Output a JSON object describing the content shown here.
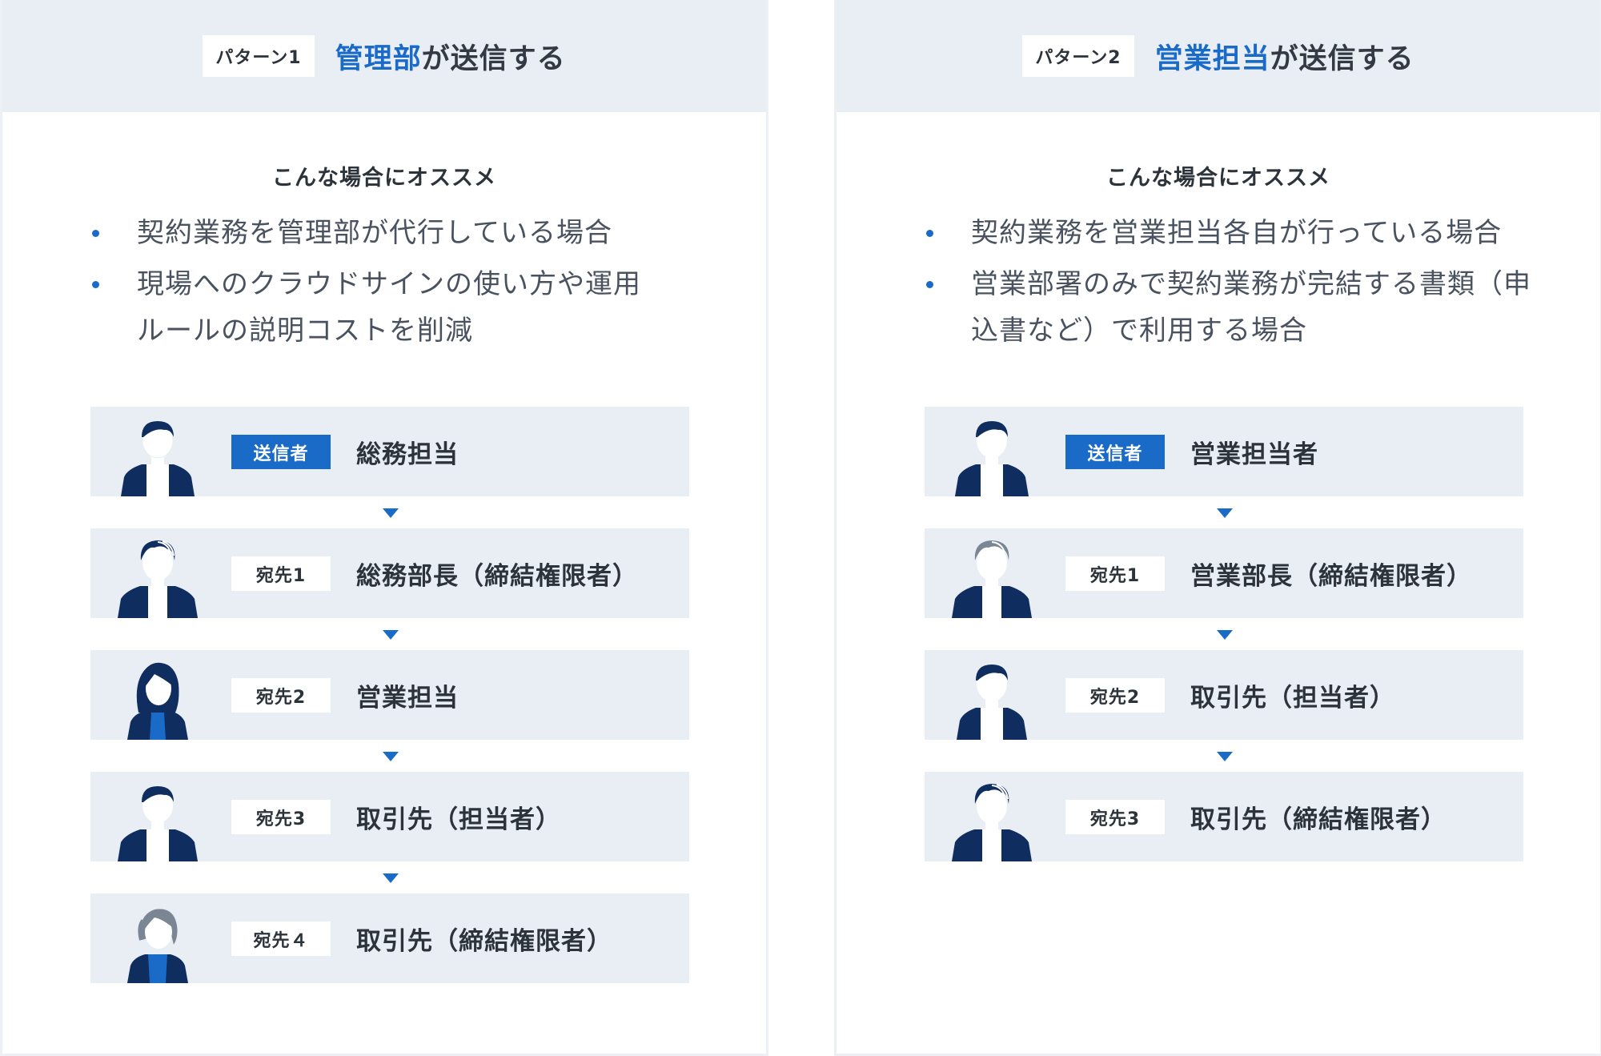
{
  "panels": [
    {
      "tag": "パターン1",
      "title_accent": "管理部",
      "title_rest": "が送信する",
      "rec_title": "こんな場合にオススメ",
      "bullets": [
        "契約業務を管理部が代行している場合",
        "現場へのクラウドサインの使い方や運用ルールの説明コストを削減"
      ],
      "steps": [
        {
          "tag": "送信者",
          "label": "総務担当",
          "avatar": "man-short-hair-icon"
        },
        {
          "tag": "宛先1",
          "label": "総務部長（締結権限者）",
          "avatar": "man-wavy-hair-icon"
        },
        {
          "tag": "宛先2",
          "label": "営業担当",
          "avatar": "woman-long-hair-icon"
        },
        {
          "tag": "宛先3",
          "label": "取引先（担当者）",
          "avatar": "man-short-hair-icon"
        },
        {
          "tag": "宛先４",
          "label": "取引先（締結権限者）",
          "avatar": "woman-gray-hair-icon"
        }
      ]
    },
    {
      "tag": "パターン2",
      "title_accent": "営業担当",
      "title_rest": "が送信する",
      "rec_title": "こんな場合にオススメ",
      "bullets": [
        "契約業務を営業担当各自が行っている場合",
        "営業部署のみで契約業務が完結する書類（申込書など）で利用する場合"
      ],
      "steps": [
        {
          "tag": "送信者",
          "label": "営業担当者",
          "avatar": "man-short-hair-icon"
        },
        {
          "tag": "宛先1",
          "label": "営業部長（締結権限者）",
          "avatar": "man-gray-hair-icon"
        },
        {
          "tag": "宛先2",
          "label": "取引先（担当者）",
          "avatar": "man-short-hair-icon"
        },
        {
          "tag": "宛先3",
          "label": "取引先（締結権限者）",
          "avatar": "man-wavy-hair-icon"
        }
      ]
    }
  ],
  "colors": {
    "accent": "#1a6bc8",
    "navy": "#0f2d5e",
    "header_bg": "#e9eef5",
    "hair_gray": "#7b8694"
  }
}
